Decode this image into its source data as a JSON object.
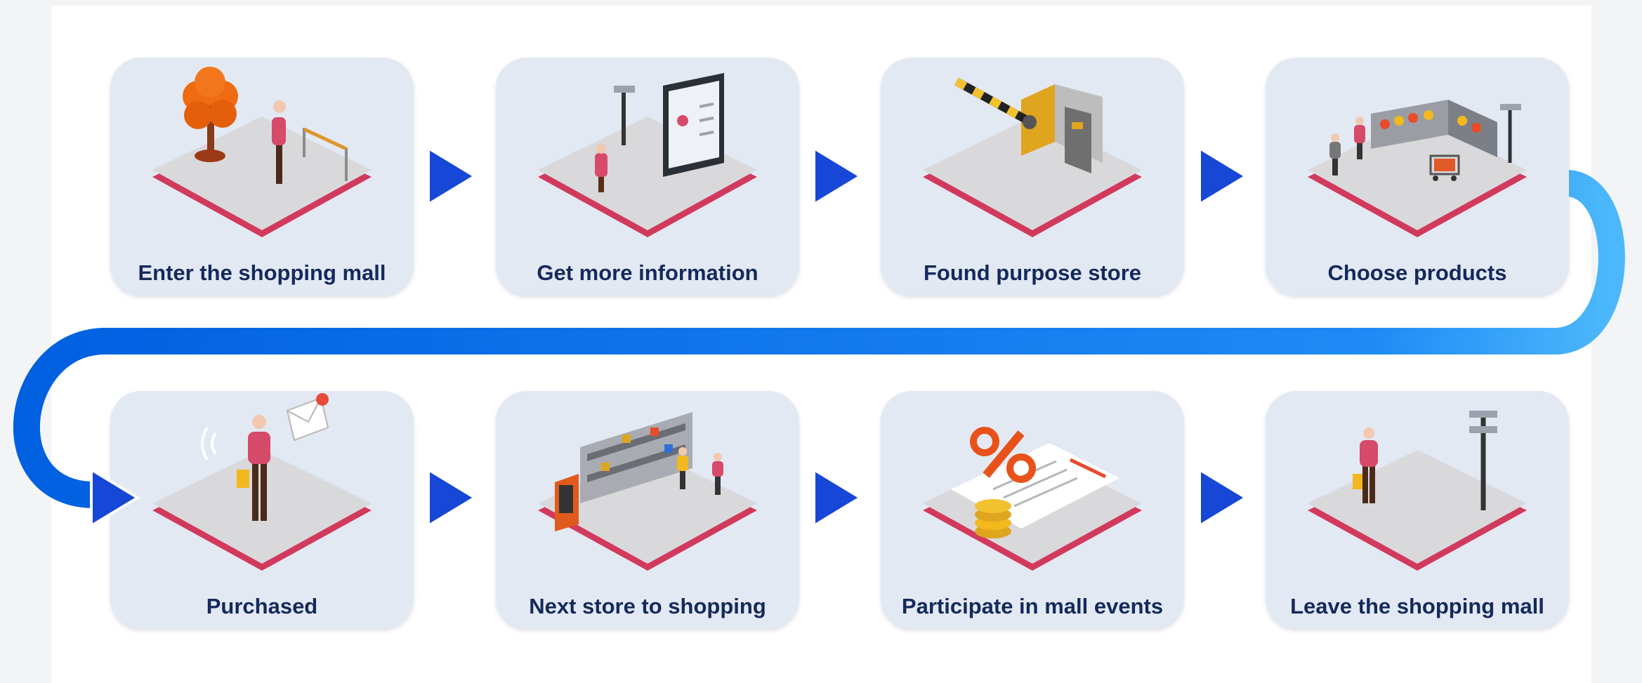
{
  "diagram": {
    "steps": [
      {
        "label": "Enter the shopping mall",
        "illustration": "tree-and-stanchion-icon"
      },
      {
        "label": "Get more information",
        "illustration": "info-screen-icon"
      },
      {
        "label": "Found purpose store",
        "illustration": "barrier-gate-icon"
      },
      {
        "label": "Choose products",
        "illustration": "produce-shelves-icon"
      },
      {
        "label": "Purchased",
        "illustration": "mobile-payment-icon"
      },
      {
        "label": "Next store to shopping",
        "illustration": "store-shelves-icon"
      },
      {
        "label": "Participate in mall events",
        "illustration": "discount-receipt-icon"
      },
      {
        "label": "Leave the shopping mall",
        "illustration": "exit-camera-icon"
      }
    ],
    "colors": {
      "card_background": "#e3e9f3",
      "label_text": "#14295c",
      "platform_top": "#d9d9dc",
      "platform_edge": "#d13a5c",
      "arrow": "#1747d6",
      "connector_dark": "#0064e6",
      "connector_light": "#4cb8fb"
    }
  }
}
